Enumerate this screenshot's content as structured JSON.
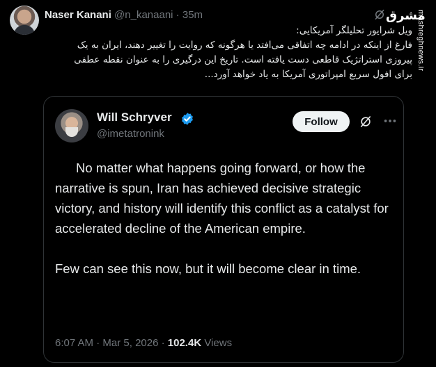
{
  "outer_tweet": {
    "author_name": "Naser Kanani",
    "author_handle": "@n_kanaani",
    "separator": " · ",
    "time_ago": "35m",
    "text_lines": [
      "ویل شرایور تحلیلگر آمریکایی:",
      "فارغ از اینکه در ادامه چه اتفاقی می‌افتد یا هرگونه که روایت را تغییر دهند، ایران به یک",
      "پیروزی استراتژیک قاطعی دست یافته است. تاریخ این درگیری را به عنوان نقطه عطفی",
      "برای افول سریع امپراتوری آمریکا به یاد خواهد آورد..."
    ]
  },
  "watermark": {
    "logo_text": "مشرق",
    "site_text": "mashreghnews.ir"
  },
  "quoted_tweet": {
    "author_name": "Will Schryver",
    "author_handle": "@imetatronink",
    "follow_label": "Follow",
    "paragraph_1": "No matter what happens going forward, or how the narrative is spun, Iran has achieved decisive strategic victory, and history will identify this conflict as a catalyst for accelerated decline of the American empire.",
    "paragraph_2": "Few can see this now, but it will become clear in time.",
    "time": "6:07 AM",
    "dot": " · ",
    "date": "Mar 5, 2026",
    "views_count": "102.4K",
    "views_label": " Views"
  },
  "icons": {
    "verified": "verified-badge-icon",
    "grok": "grok-slash-icon",
    "more": "more-dots-icon"
  },
  "colors": {
    "background": "#000000",
    "text": "#e7e9ea",
    "muted": "#71767b",
    "verified_blue": "#1d9bf0",
    "border": "#2f3336"
  }
}
